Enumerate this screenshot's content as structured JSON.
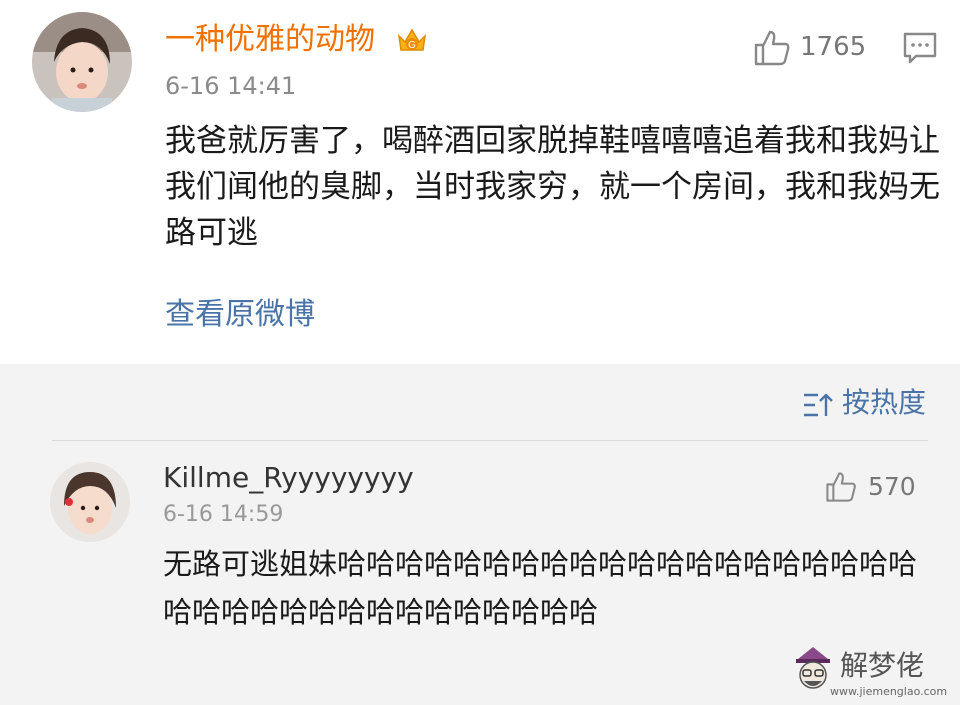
{
  "post": {
    "username": "一种优雅的动物",
    "timestamp": "6-16 14:41",
    "likes": "1765",
    "text": "我爸就厉害了，喝醉酒回家脱掉鞋嘻嘻嘻追着我和我妈让我们闻他的臭脚，当时我家穷，就一个房间，我和我妈无路可逃",
    "view_original": "查看原微博"
  },
  "comments": {
    "sort_label": "按热度",
    "items": [
      {
        "username": "Killme_Ryyyyyyyy",
        "timestamp": "6-16 14:59",
        "likes": "570",
        "text": "无路可逃姐妹哈哈哈哈哈哈哈哈哈哈哈哈哈哈哈哈哈哈哈哈哈哈哈哈哈哈哈哈哈哈哈哈哈哈哈"
      }
    ]
  },
  "watermark": {
    "text": "解梦佬",
    "url": "www.jiemenglao.com"
  },
  "colors": {
    "username_orange": "#f07000",
    "link_blue": "#4a74a8",
    "comments_bg": "#f3f3f3"
  }
}
